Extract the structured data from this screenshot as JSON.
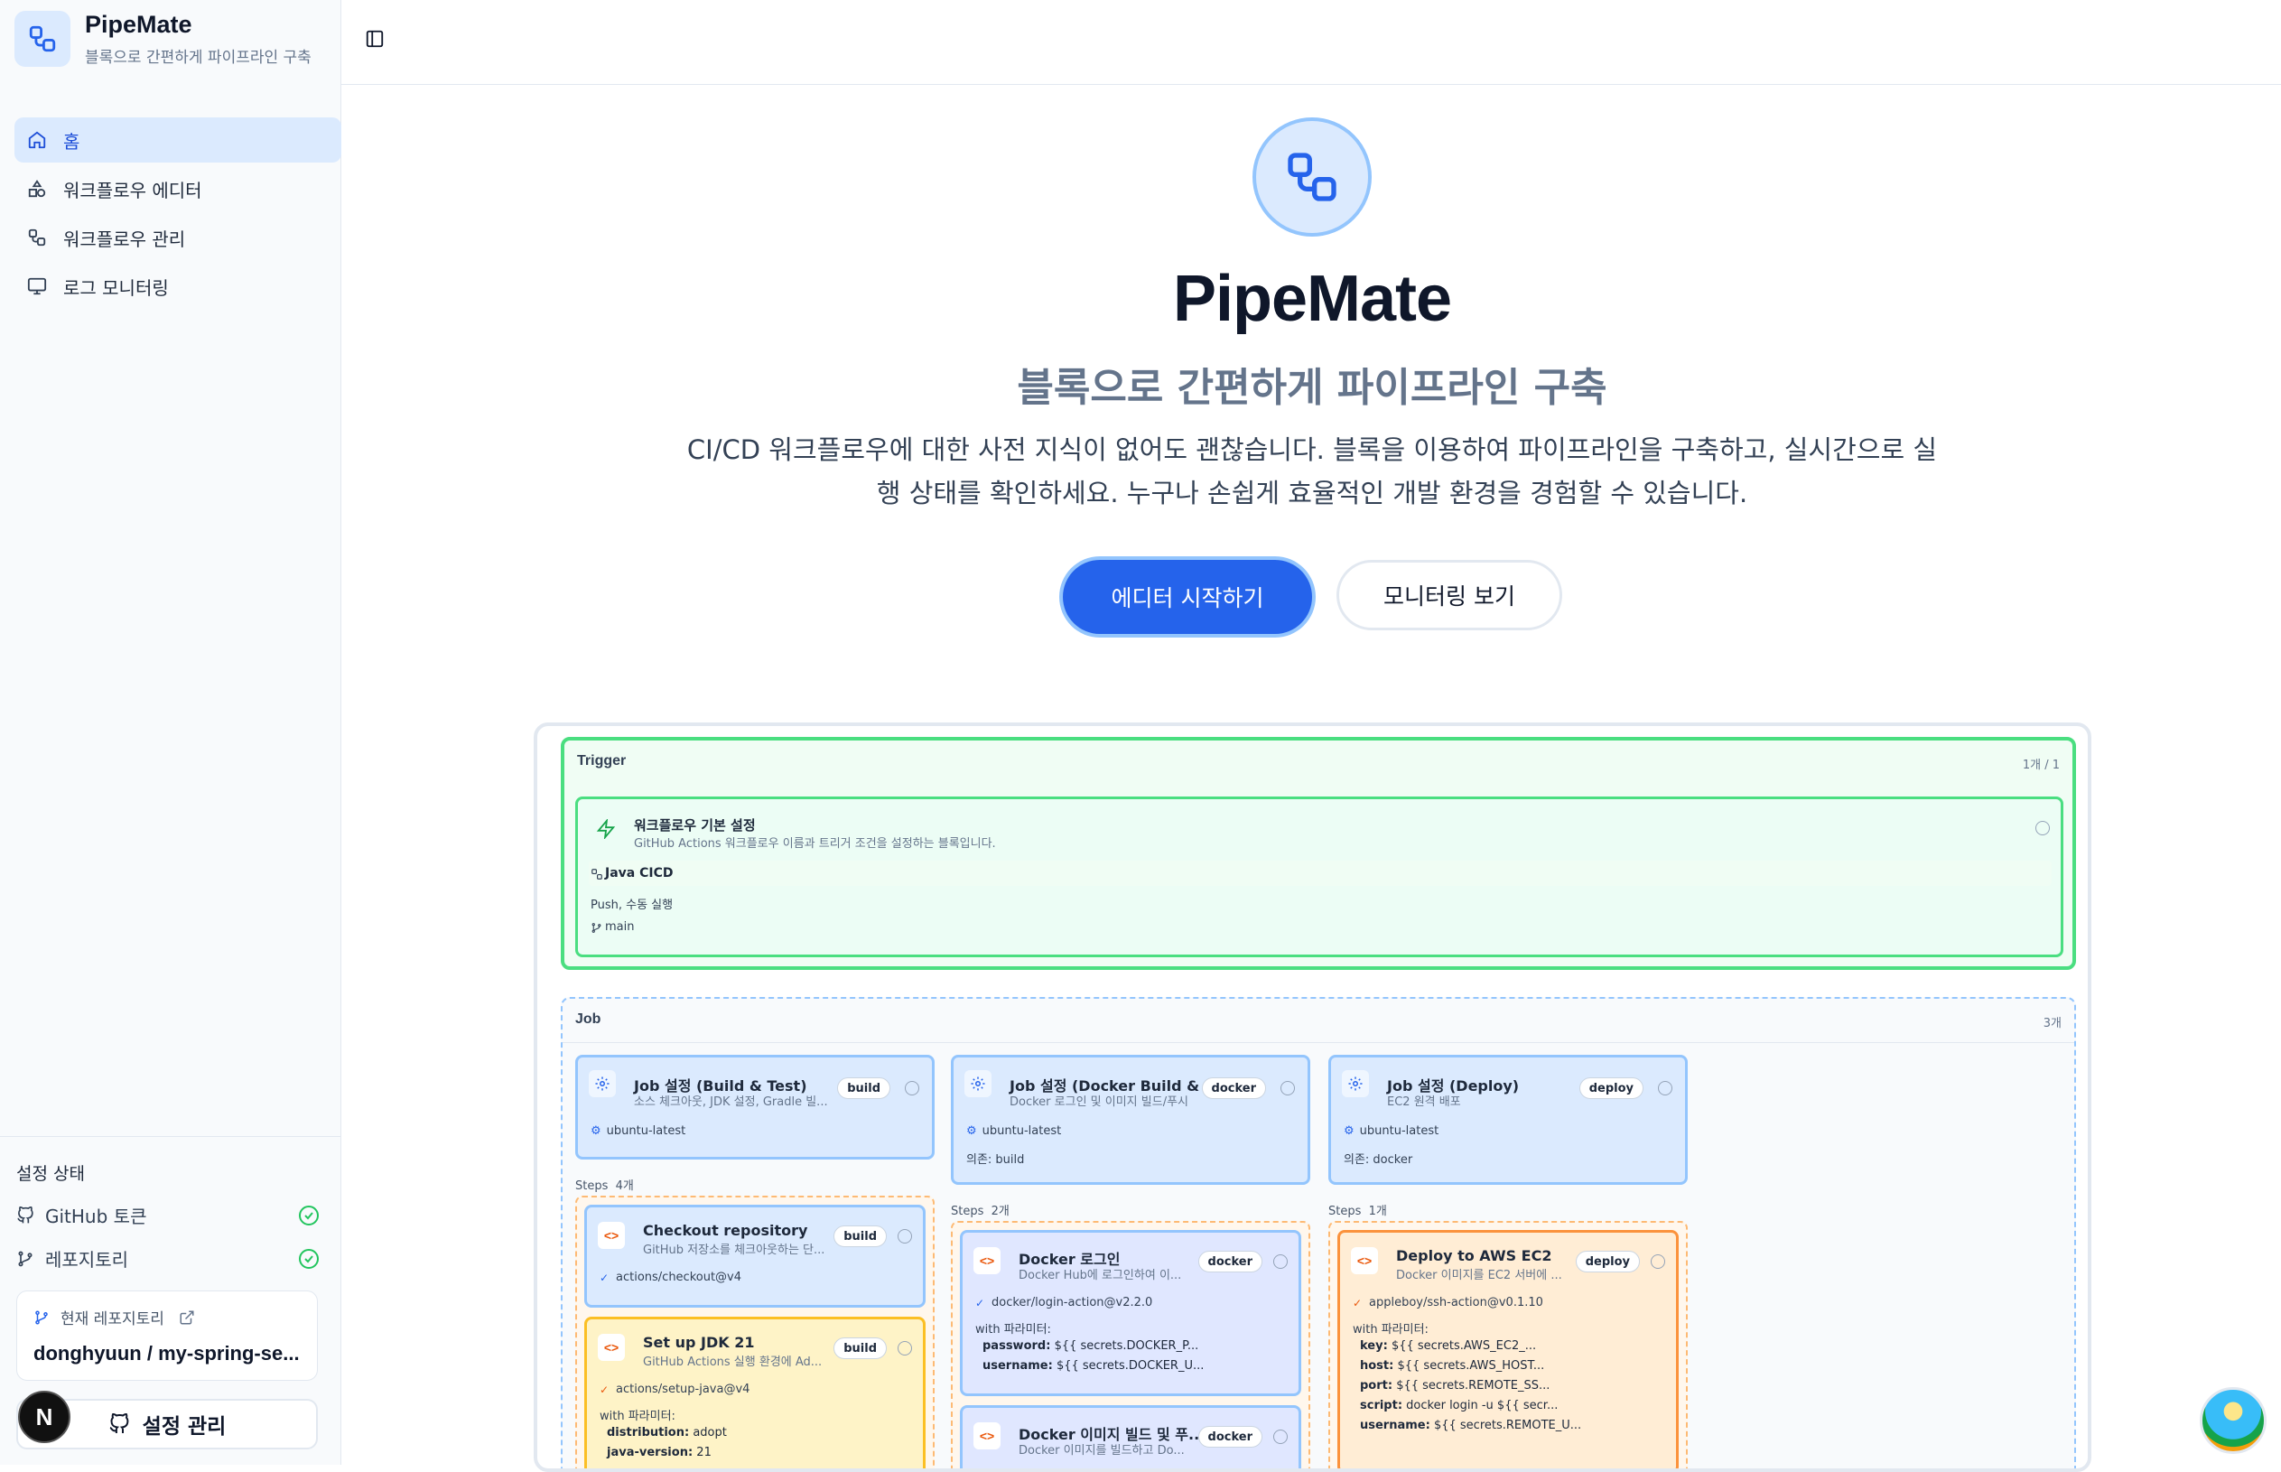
{
  "brand": {
    "name": "PipeMate",
    "subtitle": "블록으로 간편하게 파이프라인 구축"
  },
  "nav": {
    "items": [
      {
        "label": "홈",
        "icon": "home-icon",
        "active": true
      },
      {
        "label": "워크플로우 에디터",
        "icon": "shapes-icon"
      },
      {
        "label": "워크플로우 관리",
        "icon": "workflow-icon"
      },
      {
        "label": "로그 모니터링",
        "icon": "monitor-icon"
      }
    ]
  },
  "settings": {
    "title": "설정 상태",
    "github_token": "GitHub 토큰",
    "repository": "레포지토리",
    "current_repo_caption": "현재 레포지토리",
    "current_repo_name": "donghyuun / my-spring-se...",
    "manage_button": "설정 관리",
    "avatar_letter": "N"
  },
  "hero": {
    "title": "PipeMate",
    "subtitle": "블록으로 간편하게 파이프라인 구축",
    "description": "CI/CD 워크플로우에 대한 사전 지식이 없어도 괜찮습니다. 블록을 이용하여 파이프라인을 구축하고, 실시간으로 실행 상태를 확인하세요. 누구나 손쉽게 효율적인 개발 환경을 경험할 수 있습니다.",
    "primary_button": "에디터 시작하기",
    "secondary_button": "모니터링 보기"
  },
  "preview": {
    "trigger": {
      "label": "Trigger",
      "count": "1개 / 1",
      "card_title": "워크플로우 기본 설정",
      "card_sub": "GitHub Actions 워크플로우 이름과 트리거 조건을 설정하는 블록입니다.",
      "workflow_name": "Java CICD",
      "events": "Push, 수동 실행",
      "branch": "main"
    },
    "jobs": {
      "label": "Job",
      "count": "3개",
      "cards": [
        {
          "title": "Job 설정 (Build & Test)",
          "sub": "소스 체크아웃, JDK 설정, Gradle 빌...",
          "badge": "build",
          "runner": "ubuntu-latest",
          "needs": ""
        },
        {
          "title": "Job 설정 (Docker Build & ...",
          "sub": "Docker 로그인 및 이미지 빌드/푸시",
          "badge": "docker",
          "runner": "ubuntu-latest",
          "needs": "의존: build"
        },
        {
          "title": "Job 설정 (Deploy)",
          "sub": "EC2 원격 배포",
          "badge": "deploy",
          "runner": "ubuntu-latest",
          "needs": "의존: docker"
        }
      ],
      "steps_label": "Steps",
      "steps_counts": [
        "4개",
        "2개",
        "1개"
      ],
      "steps": {
        "build": [
          {
            "title": "Checkout repository",
            "sub": "GitHub 저장소를 체크아웃하는 단...",
            "badge": "build",
            "uses": "actions/checkout@v4"
          },
          {
            "title": "Set up JDK 21",
            "sub": "GitHub Actions 실행 환경에 Ad...",
            "badge": "build",
            "uses": "actions/setup-java@v4",
            "with_label": "with 파라미터:",
            "params": [
              [
                "distribution:",
                "adopt"
              ],
              [
                "java-version:",
                "21"
              ]
            ]
          }
        ],
        "docker": [
          {
            "title": "Docker 로그인",
            "sub": "Docker Hub에 로그인하여 이...",
            "badge": "docker",
            "uses": "docker/login-action@v2.2.0",
            "with_label": "with 파라미터:",
            "params": [
              [
                "password:",
                "${{ secrets.DOCKER_P..."
              ],
              [
                "username:",
                "${{ secrets.DOCKER_U..."
              ]
            ]
          },
          {
            "title": "Docker 이미지 빌드 및 푸...",
            "sub": "Docker 이미지를 빌드하고 Do...",
            "badge": "docker"
          }
        ],
        "deploy": [
          {
            "title": "Deploy to AWS EC2",
            "sub": "Docker 이미지를 EC2 서버에 ...",
            "badge": "deploy",
            "uses": "appleboy/ssh-action@v0.1.10",
            "with_label": "with 파라미터:",
            "params": [
              [
                "key:",
                "${{ secrets.AWS_EC2_..."
              ],
              [
                "host:",
                "${{ secrets.AWS_HOST..."
              ],
              [
                "port:",
                "${{ secrets.REMOTE_SS..."
              ],
              [
                "script:",
                "docker login -u ${{ secr..."
              ],
              [
                "username:",
                "${{ secrets.REMOTE_U..."
              ]
            ]
          }
        ]
      }
    }
  }
}
